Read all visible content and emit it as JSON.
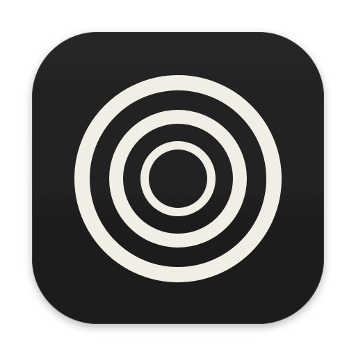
{
  "app_icon": {
    "icon_name": "concentric-rings-icon",
    "shape": "rounded-square",
    "rings": 3,
    "colors": {
      "tile_background": "#1f1f1f",
      "tile_edge_highlight": "#3a3a3a",
      "ring": "#f1efe5",
      "page_background": "#ffffff"
    }
  }
}
